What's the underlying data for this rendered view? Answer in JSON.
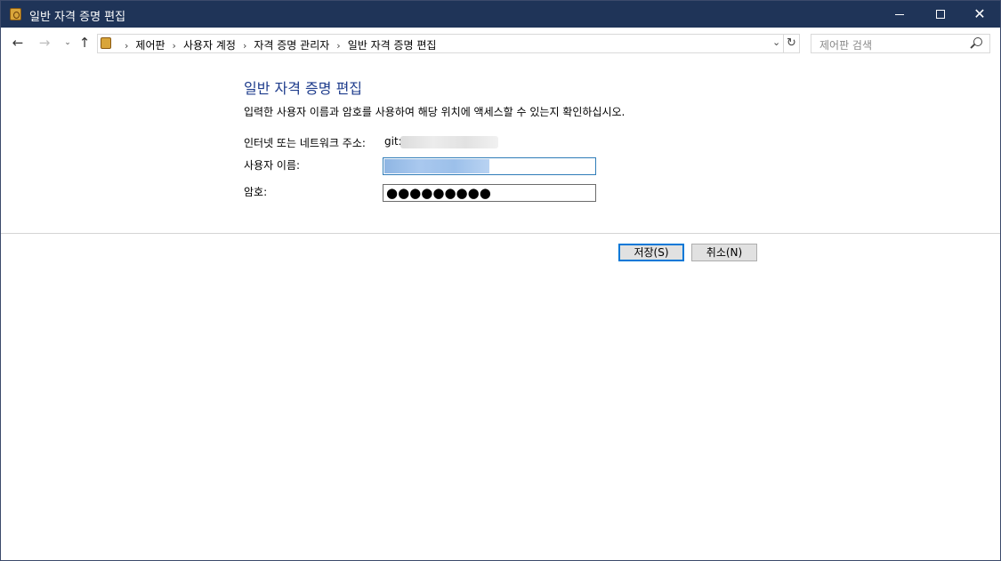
{
  "window": {
    "title": "일반 자격 증명 편집",
    "controls": {
      "minimize": "minimize",
      "maximize": "maximize",
      "close": "✕"
    }
  },
  "nav": {
    "back": "←",
    "forward": "→",
    "recent": "⌄",
    "up": "↑",
    "breadcrumbs": [
      "제어판",
      "사용자 계정",
      "자격 증명 관리자",
      "일반 자격 증명 편집"
    ],
    "separator": "›",
    "dropdown": "⌄",
    "refresh": "↻",
    "search_placeholder": "제어판 검색"
  },
  "form": {
    "heading": "일반 자격 증명 편집",
    "description": "입력한 사용자 이름과 암호를 사용하여 해당 위치에 액세스할 수 있는지 확인하십시오.",
    "address_label": "인터넷 또는 네트워크 주소:",
    "address_value": "git:",
    "username_label": "사용자 이름:",
    "password_label": "암호:",
    "password_mask": "●●●●●●●●●"
  },
  "buttons": {
    "save": "저장(S)",
    "cancel": "취소(N)"
  },
  "colors": {
    "titlebar": "#1f3458",
    "heading": "#1e3c8c",
    "focus": "#0078d7"
  }
}
